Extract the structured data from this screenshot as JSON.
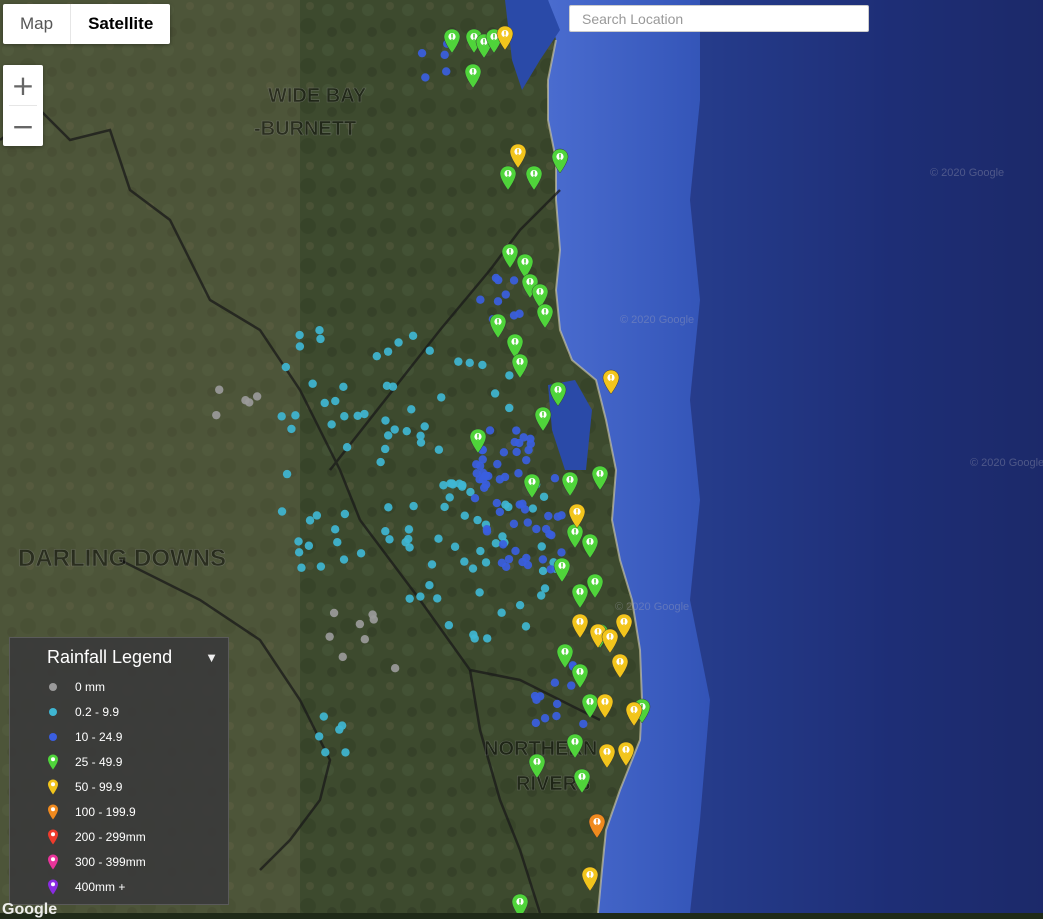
{
  "map_type": {
    "options": [
      "Map",
      "Satellite"
    ],
    "selected": "Satellite"
  },
  "zoom": {
    "in": "+",
    "out": "−"
  },
  "search": {
    "placeholder": "Search Location",
    "value": ""
  },
  "legend": {
    "title": "Rainfall Legend",
    "items": [
      {
        "label": "0 mm",
        "symbol": "dot",
        "color": "#9a9a9a"
      },
      {
        "label": "0.2 - 9.9",
        "symbol": "dot",
        "color": "#3fb6d2"
      },
      {
        "label": "10 - 24.9",
        "symbol": "dot",
        "color": "#3a5ee0"
      },
      {
        "label": "25 - 49.9",
        "symbol": "pin",
        "color": "#4fd43a"
      },
      {
        "label": "50 - 99.9",
        "symbol": "pin",
        "color": "#f2c51c"
      },
      {
        "label": "100 - 199.9",
        "symbol": "pin",
        "color": "#f08a1e"
      },
      {
        "label": "200 - 299mm",
        "symbol": "pin",
        "color": "#ef3b2c"
      },
      {
        "label": "300 - 399mm",
        "symbol": "pin",
        "color": "#e9339a"
      },
      {
        "label": "400mm +",
        "symbol": "pin",
        "color": "#8a2be2"
      }
    ]
  },
  "map_labels": [
    "WIDE BAY",
    "-BURNETT",
    "DARLING DOWNS",
    "NORTHERN",
    "RIVERS"
  ],
  "watermark": "© 2020 Google",
  "attribution": "Google",
  "colors": {
    "land": "#3a4a2c",
    "ocean": "#2a3f9a",
    "deep_ocean": "#1d2c6e"
  }
}
